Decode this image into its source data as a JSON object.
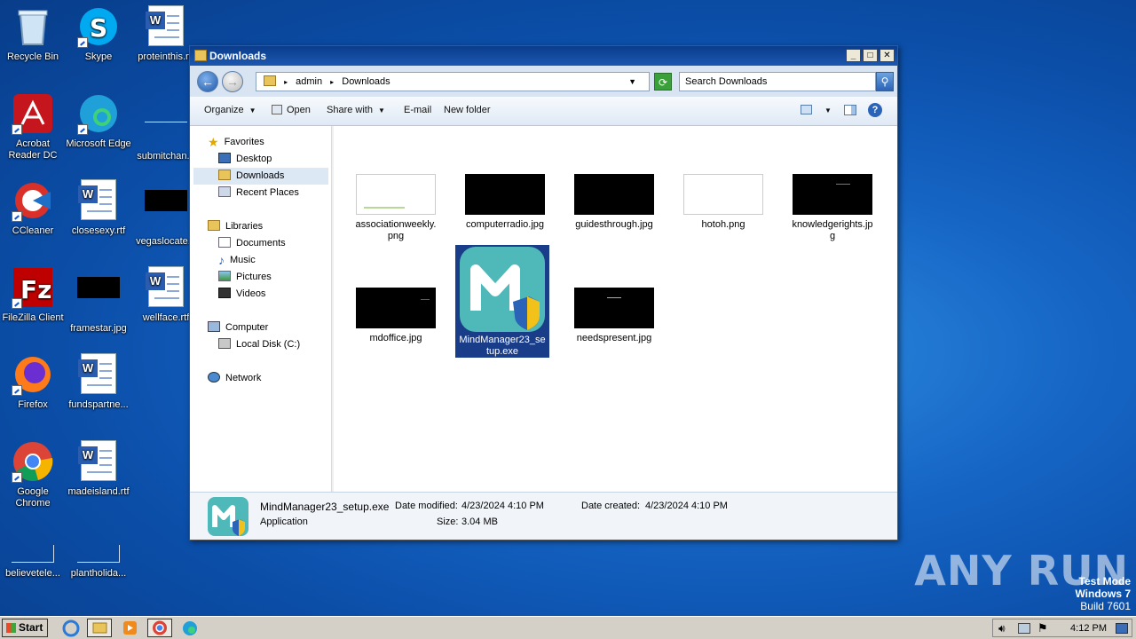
{
  "desktop": {
    "icons": [
      {
        "label": "Recycle Bin"
      },
      {
        "label": "Skype"
      },
      {
        "label": "proteinthis.rtf"
      },
      {
        "label": "Acrobat Reader DC"
      },
      {
        "label": "Microsoft Edge"
      },
      {
        "label": "submitchan..."
      },
      {
        "label": "CCleaner"
      },
      {
        "label": "closesexy.rtf"
      },
      {
        "label": "vegaslocate..."
      },
      {
        "label": "FileZilla Client"
      },
      {
        "label": "framestar.jpg"
      },
      {
        "label": "wellface.rtf"
      },
      {
        "label": "Firefox"
      },
      {
        "label": "fundspartne..."
      },
      {
        "label": "Google Chrome"
      },
      {
        "label": "madeisland.rtf"
      },
      {
        "label": "believetele..."
      },
      {
        "label": "plantholida..."
      }
    ]
  },
  "window": {
    "title": "Downloads",
    "address": {
      "segments": [
        "admin",
        "Downloads"
      ]
    },
    "search_placeholder": "Search Downloads",
    "toolbar": {
      "organize": "Organize",
      "open": "Open",
      "share": "Share with",
      "email": "E-mail",
      "newfolder": "New folder"
    },
    "nav": {
      "favorites": "Favorites",
      "desktop": "Desktop",
      "downloads": "Downloads",
      "recent": "Recent Places",
      "libraries": "Libraries",
      "documents": "Documents",
      "music": "Music",
      "pictures": "Pictures",
      "videos": "Videos",
      "computer": "Computer",
      "localdisk": "Local Disk (C:)",
      "network": "Network"
    },
    "files": [
      {
        "name": "associationweekly.png",
        "line1": "associationweekly.",
        "line2": "png"
      },
      {
        "name": "computerradio.jpg"
      },
      {
        "name": "guidesthrough.jpg"
      },
      {
        "name": "hotoh.png"
      },
      {
        "name": "knowledgerights.jpg",
        "line1": "knowledgerights.jp",
        "line2": "g"
      },
      {
        "name": "mdoffice.jpg"
      },
      {
        "name": "MindManager23_setup.exe",
        "line1": "MindManager23_se",
        "line2": "tup.exe"
      },
      {
        "name": "needspresent.jpg"
      }
    ],
    "details": {
      "filename": "MindManager23_setup.exe",
      "type": "Application",
      "modified_label": "Date modified:",
      "modified": "4/23/2024 4:10 PM",
      "created_label": "Date created:",
      "created": "4/23/2024 4:10 PM",
      "size_label": "Size:",
      "size": "3.04 MB"
    }
  },
  "taskbar": {
    "start": "Start",
    "clock": "4:12 PM"
  },
  "watermark": {
    "brand": "ANY RUN",
    "testmode": "Test Mode",
    "os": "Windows 7",
    "build": "Build 7601"
  }
}
